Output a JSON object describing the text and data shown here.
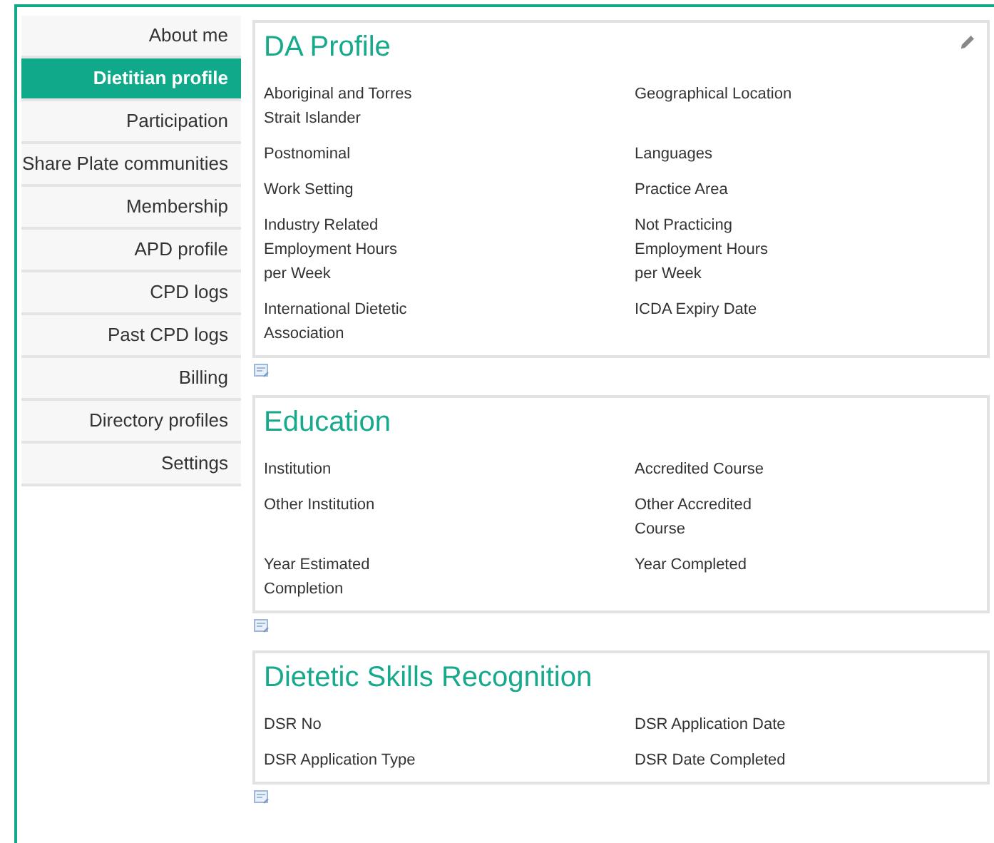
{
  "sidebar": {
    "items": [
      {
        "label": "About me",
        "selected": false
      },
      {
        "label": "Dietitian profile",
        "selected": true
      },
      {
        "label": "Participation",
        "selected": false
      },
      {
        "label": "Share Plate communities",
        "selected": false
      },
      {
        "label": "Membership",
        "selected": false
      },
      {
        "label": "APD profile",
        "selected": false
      },
      {
        "label": "CPD logs",
        "selected": false
      },
      {
        "label": "Past CPD logs",
        "selected": false
      },
      {
        "label": "Billing",
        "selected": false
      },
      {
        "label": "Directory profiles",
        "selected": false
      },
      {
        "label": "Settings",
        "selected": false
      }
    ]
  },
  "sections": [
    {
      "title": "DA Profile",
      "editable": true,
      "fields": [
        "Aboriginal and Torres Strait Islander",
        "Geographical Location",
        "Postnominal",
        "Languages",
        "Work Setting",
        "Practice Area",
        "Industry Related Employment Hours per Week",
        "Not Practicing Employment Hours per Week",
        "International Dietetic Association",
        "ICDA Expiry Date"
      ]
    },
    {
      "title": "Education",
      "editable": false,
      "fields": [
        "Institution",
        "Accredited Course",
        "Other Institution",
        "Other Accredited Course",
        "Year Estimated Completion",
        "Year Completed"
      ]
    },
    {
      "title": "Dietetic Skills Recognition",
      "editable": false,
      "fields": [
        "DSR No",
        "DSR Application Date",
        "DSR Application Type",
        "DSR Date Completed"
      ]
    }
  ]
}
